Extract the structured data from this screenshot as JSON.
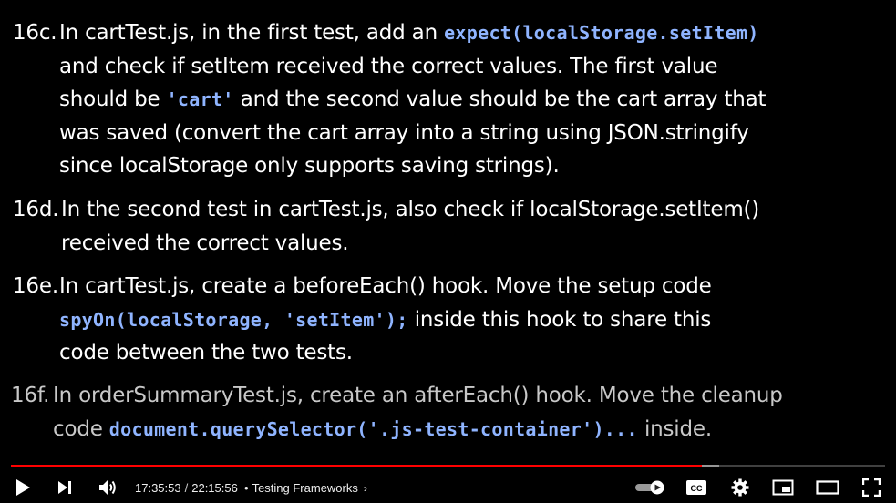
{
  "steps": {
    "s16c": {
      "number": "16c.",
      "l1_text": "In cartTest.js, in the first test, add an",
      "l1_code": "expect(localStorage.setItem)",
      "l2": "and check if setItem received the correct values. The first value",
      "l3_a": "should be",
      "l3_code": "'cart'",
      "l3_b": "and the second value should be the cart array that",
      "l4": "was saved (convert the cart array into a string using JSON.stringify",
      "l5": "since localStorage only supports saving strings)."
    },
    "s16d": {
      "number": "16d.",
      "l1": "In the second test in cartTest.js, also check if localStorage.setItem()",
      "l2": "received the correct values."
    },
    "s16e": {
      "number": "16e.",
      "l1": "In cartTest.js, create a beforeEach() hook. Move the setup code",
      "l2_code": "spyOn(localStorage, 'setItem');",
      "l2_text": "inside this hook to share this",
      "l3": "code between the two tests."
    },
    "s16f": {
      "number": "16f.",
      "l1": "In orderSummaryTest.js, create an afterEach() hook. Move the cleanup",
      "l2_a": "code",
      "l2_code": "document.querySelector('.js-test-container')...",
      "l2_b": "inside."
    }
  },
  "player": {
    "current_time": "17:35:53",
    "separator": "/",
    "duration": "22:15:56",
    "chapter_bullet": "•",
    "chapter_title": "Testing Frameworks",
    "chapter_chevron": "›",
    "progress_fraction": 0.79,
    "loaded_fraction": 0.81,
    "autoplay": true,
    "accent_color": "#ff0000",
    "icons": {
      "play": "play-icon",
      "next": "next-icon",
      "volume": "volume-icon",
      "autoplay": "autoplay-toggle-icon",
      "captions": "captions-icon",
      "settings": "gear-icon",
      "miniplayer": "miniplayer-icon",
      "theater": "theater-icon",
      "fullscreen": "fullscreen-icon"
    },
    "captions_label": "CC"
  },
  "colors": {
    "background": "#000000",
    "text": "#ffffff",
    "code": "#8fb4ff"
  }
}
